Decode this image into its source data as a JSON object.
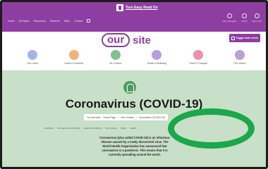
{
  "header": {
    "easy_read_label": "Turn Easy Read On",
    "nav_items": [
      "Home",
      "All Topics",
      "Resources",
      "Services",
      "Work",
      "Contact"
    ],
    "utilities": [
      {
        "label": "easy read guide",
        "icon": "question-icon"
      },
      {
        "label": "search",
        "icon": "search-icon"
      },
      {
        "label": "log in / join",
        "icon": "user-icon"
      }
    ]
  },
  "logo": {
    "our": "our",
    "site": "site"
  },
  "toggle_menu_label": "Toggle main menu",
  "categories": [
    {
      "label": "Your Home",
      "icon": "home-icon",
      "color": "#9fb8e8"
    },
    {
      "label": "Leisure & Activities",
      "icon": "balloon-icon",
      "color": "#f2b27a"
    },
    {
      "label": "Life Choices",
      "icon": "person-icon",
      "color": "#7fc48e"
    },
    {
      "label": "Health & Wellbeing",
      "icon": "heart-icon",
      "color": "#b69fe0"
    },
    {
      "label": "Travel & Transport",
      "icon": "bus-icon",
      "color": "#f08fa8"
    },
    {
      "label": "Free Stories",
      "icon": "book-icon",
      "color": "#b8a0d8"
    }
  ],
  "page": {
    "title": "Coronavirus (COVID-19)",
    "breadcrumb": [
      "You are here:",
      "Home Page",
      "/",
      "Life Choices",
      "/",
      "Coronavirus (COVID-19)"
    ],
    "meta": [
      "Published",
      "Coronavirus (COVID-19)",
      "Health & Wellbeing",
      "Life Choices",
      "Public",
      "Health"
    ],
    "intro_lines": [
      "Coronavirus (also called COVID-19) is an infectious",
      "disease caused by a newly discovered virus. The",
      "World Health Organisation has announced that",
      "coronavirus is a pandemic. This means that it is",
      "currently spreading around the world."
    ]
  },
  "annotation": {
    "color": "#1aa84a"
  }
}
